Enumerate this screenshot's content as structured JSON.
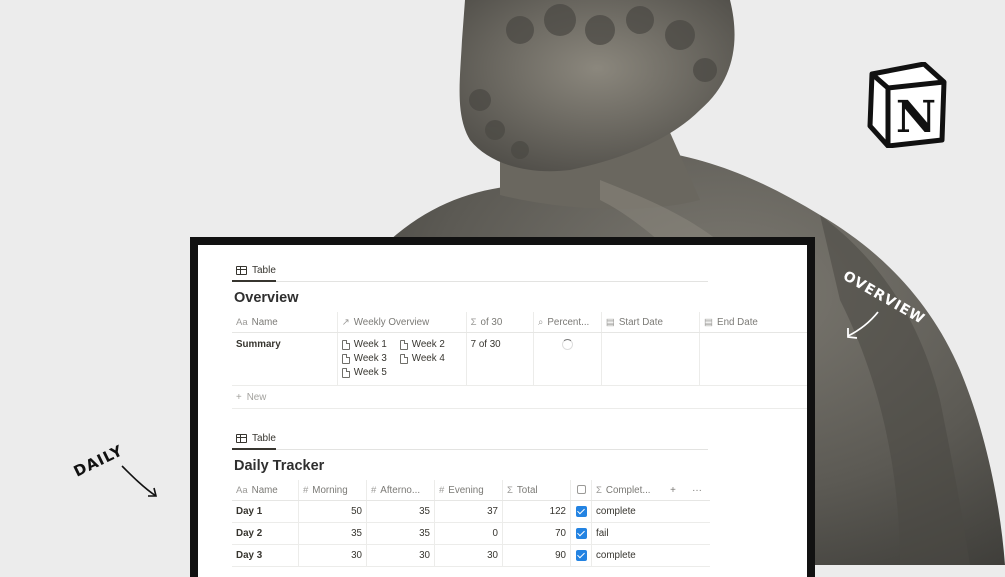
{
  "annotations": {
    "daily": "DAILY",
    "overview": "OVERVIEW"
  },
  "logo": {
    "letter": "N"
  },
  "overview_db": {
    "view_tab": "Table",
    "title": "Overview",
    "columns": [
      {
        "icon": "Aa",
        "label": "Name"
      },
      {
        "icon": "↗",
        "label": "Weekly Overview"
      },
      {
        "icon": "Σ",
        "label": "of 30"
      },
      {
        "icon": "⌕",
        "label": "Percent..."
      },
      {
        "icon": "▤",
        "label": "Start Date"
      },
      {
        "icon": "▤",
        "label": "End Date"
      }
    ],
    "row": {
      "name": "Summary",
      "weeks": [
        "Week 1",
        "Week 2",
        "Week 3",
        "Week 4",
        "Week 5"
      ],
      "of_30": "7 of 30"
    },
    "new_label": "New"
  },
  "daily_db": {
    "view_tab": "Table",
    "title": "Daily Tracker",
    "columns": [
      {
        "icon": "Aa",
        "label": "Name"
      },
      {
        "icon": "#",
        "label": "Morning"
      },
      {
        "icon": "#",
        "label": "Afterno..."
      },
      {
        "icon": "#",
        "label": "Evening"
      },
      {
        "icon": "Σ",
        "label": "Total"
      },
      {
        "icon": "",
        "label": ""
      },
      {
        "icon": "Σ",
        "label": "Complet..."
      }
    ],
    "rows": [
      {
        "name": "Day 1",
        "morning": "50",
        "afternoon": "35",
        "evening": "37",
        "total": "122",
        "checked": true,
        "status": "complete"
      },
      {
        "name": "Day 2",
        "morning": "35",
        "afternoon": "35",
        "evening": "0",
        "total": "70",
        "checked": true,
        "status": "fail"
      },
      {
        "name": "Day 3",
        "morning": "30",
        "afternoon": "30",
        "evening": "30",
        "total": "90",
        "checked": true,
        "status": "complete"
      }
    ],
    "add_symbol": "+",
    "more_symbol": "···"
  },
  "colors": {
    "checkbox": "#2383e2",
    "frame": "#111111"
  }
}
